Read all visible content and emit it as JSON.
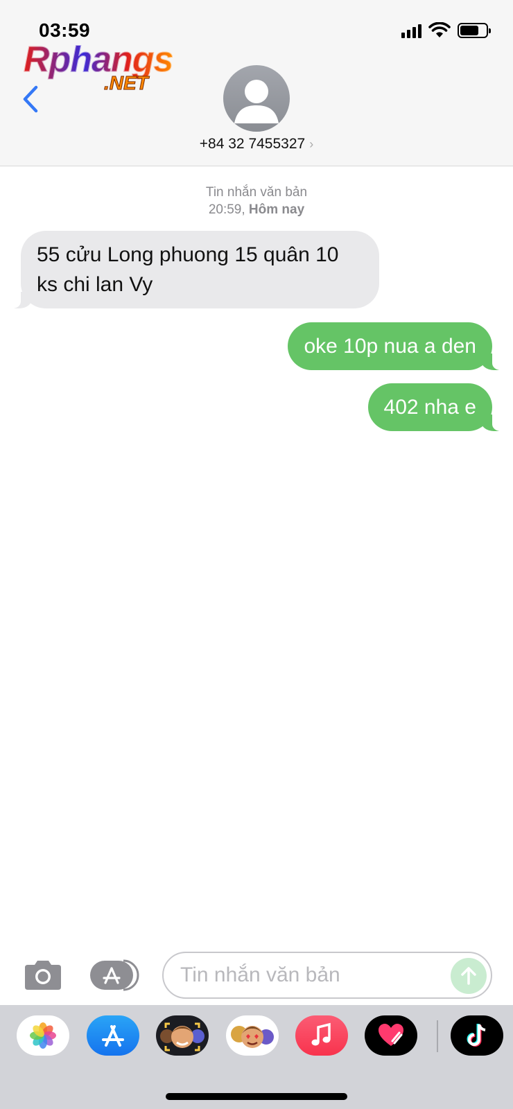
{
  "status_bar": {
    "time": "03:59"
  },
  "watermark": {
    "main": "Rphangs",
    "suffix": ".NET"
  },
  "contact": {
    "phone": "+84 32 7455327",
    "chevron": "›"
  },
  "conversation": {
    "type_label": "Tin nhắn văn bản",
    "time": "20:59,",
    "day": "Hôm nay",
    "messages": [
      {
        "direction": "incoming",
        "text": "55 cửu Long phuong 15 quân 10 ks chi lan Vy"
      },
      {
        "direction": "outgoing",
        "text": "oke 10p nua a den"
      },
      {
        "direction": "outgoing",
        "text": "402 nha e"
      }
    ]
  },
  "composer": {
    "placeholder": "Tin nhắn văn bản"
  },
  "app_drawer": {
    "apps": [
      "photos-icon",
      "app-store-icon",
      "memoji-camera-icon",
      "memoji-stickers-icon",
      "music-icon",
      "heart-app-icon",
      "tiktok-icon"
    ]
  },
  "colors": {
    "accent_blue": "#3478f6",
    "outgoing_bubble": "#65c466",
    "incoming_bubble": "#e9e9eb"
  }
}
